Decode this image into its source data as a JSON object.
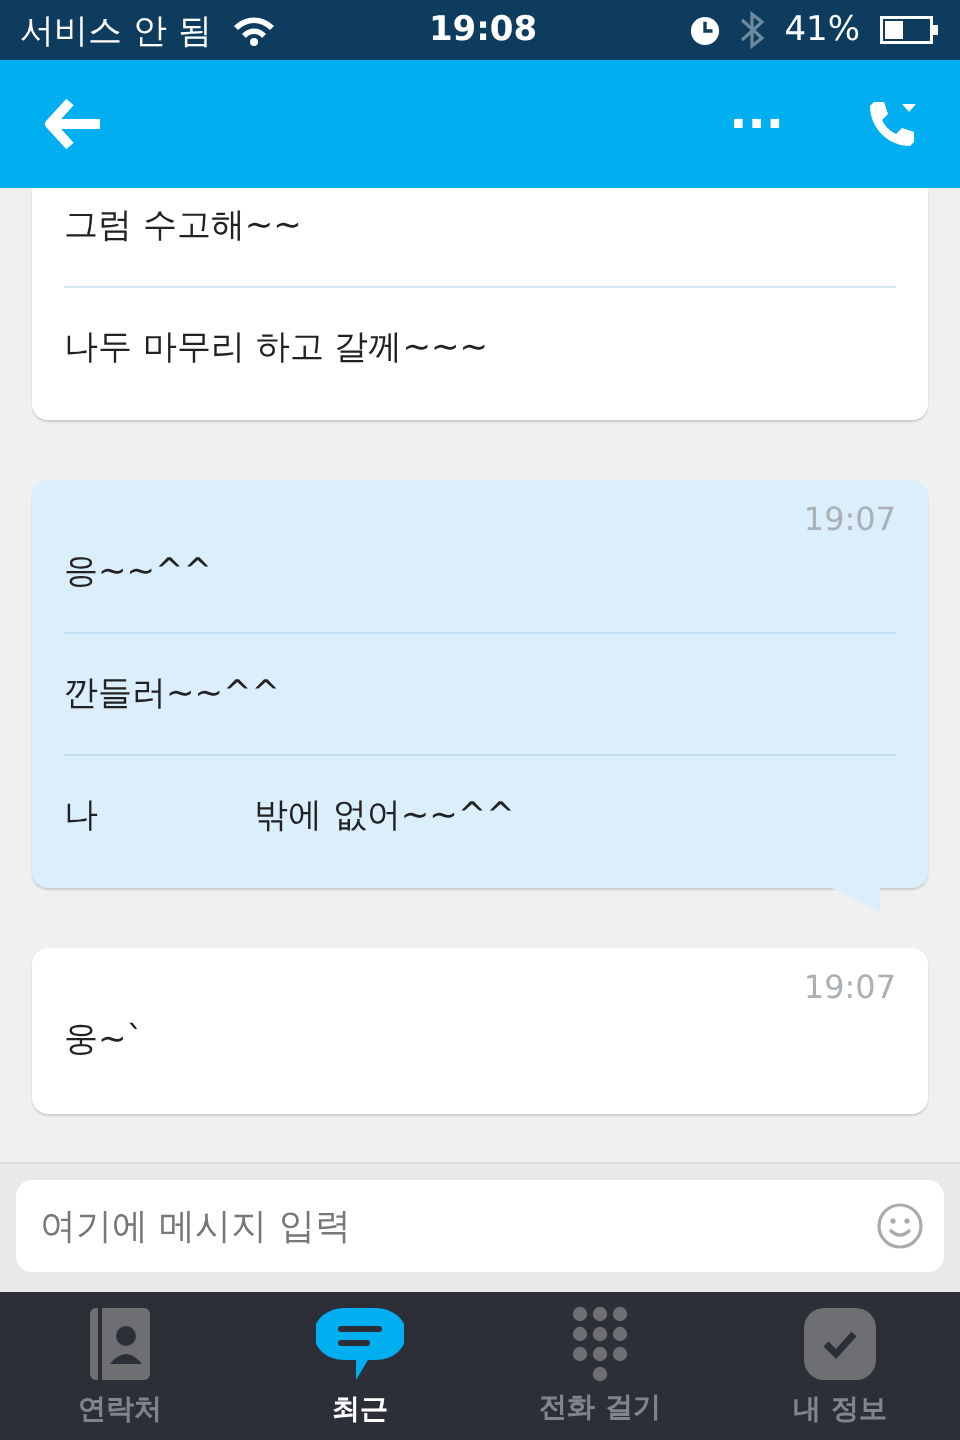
{
  "status_bar": {
    "carrier": "서비스 안 됨",
    "time": "19:08",
    "battery_text": "41%"
  },
  "header": {
    "more": "..."
  },
  "messages": [
    {
      "kind": "incoming",
      "lines": [
        [
          "그럼 수고해~~"
        ],
        [
          "나두 마무리 하고 갈께~~~"
        ]
      ]
    },
    {
      "kind": "outgoing",
      "time": "19:07",
      "lines": [
        [
          "응~~^^"
        ],
        [
          "깐들러~~^^"
        ],
        [
          "나",
          "밖에 없어~~^^"
        ]
      ]
    },
    {
      "kind": "incoming",
      "time": "19:07",
      "lines": [
        [
          "웅~`"
        ]
      ]
    }
  ],
  "composer": {
    "placeholder": "여기에 메시지 입력"
  },
  "tabs": [
    {
      "label": "연락처",
      "selected": false
    },
    {
      "label": "최근",
      "selected": true
    },
    {
      "label": "전화 걸기",
      "selected": false
    },
    {
      "label": "내 정보",
      "selected": false
    }
  ]
}
